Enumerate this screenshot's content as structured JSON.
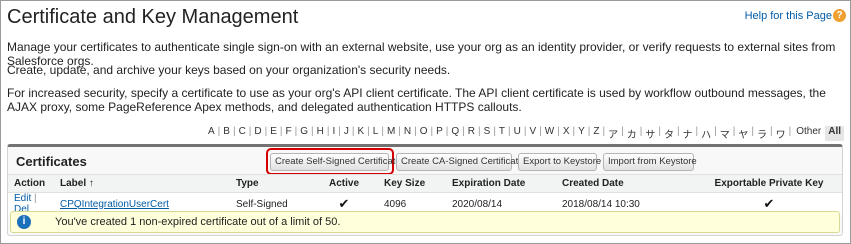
{
  "page": {
    "title": "Certificate and Key Management",
    "help_link": "Help for this Page",
    "help_icon": "?",
    "desc1": "Manage your certificates to authenticate single sign-on with an external website, use your org as an identity provider, or verify requests to external sites from Salesforce orgs.",
    "desc2": "Create, update, and archive your keys based on your organization's security needs.",
    "desc3": "For increased security, specify a certificate to use as your org's API client certificate. The API client certificate is used by workflow outbound messages, the AJAX proxy, some PageReference Apex methods, and delegated authentication HTTPS callouts."
  },
  "alpha_index": [
    "A",
    "B",
    "C",
    "D",
    "E",
    "F",
    "G",
    "H",
    "I",
    "J",
    "K",
    "L",
    "M",
    "N",
    "O",
    "P",
    "Q",
    "R",
    "S",
    "T",
    "U",
    "V",
    "W",
    "X",
    "Y",
    "Z",
    "ア",
    "カ",
    "サ",
    "タ",
    "ナ",
    "ハ",
    "マ",
    "ヤ",
    "ラ",
    "ワ"
  ],
  "alpha_other": "Other",
  "alpha_all": "All",
  "certificates": {
    "title": "Certificates",
    "buttons": {
      "create_self_signed": "Create Self-Signed Certificate",
      "create_ca_signed": "Create CA-Signed Certificate",
      "export_keystore": "Export to Keystore",
      "import_keystore": "Import from Keystore"
    },
    "columns": {
      "action": "Action",
      "label": "Label",
      "sort_indicator": "↑",
      "type": "Type",
      "active": "Active",
      "key_size": "Key Size",
      "expiration": "Expiration Date",
      "created": "Created Date",
      "exportable": "Exportable Private Key"
    },
    "rows": [
      {
        "edit": "Edit",
        "sep": "|",
        "del": "Del",
        "label": "CPQIntegrationUserCert",
        "type": "Self-Signed",
        "active": "✔",
        "key_size": "4096",
        "expiration": "2020/08/14",
        "created": "2018/08/14 10:30",
        "exportable": "✔"
      }
    ],
    "info_icon": "i",
    "info_message": "You've created 1 non-expired certificate out of a limit of 50."
  }
}
